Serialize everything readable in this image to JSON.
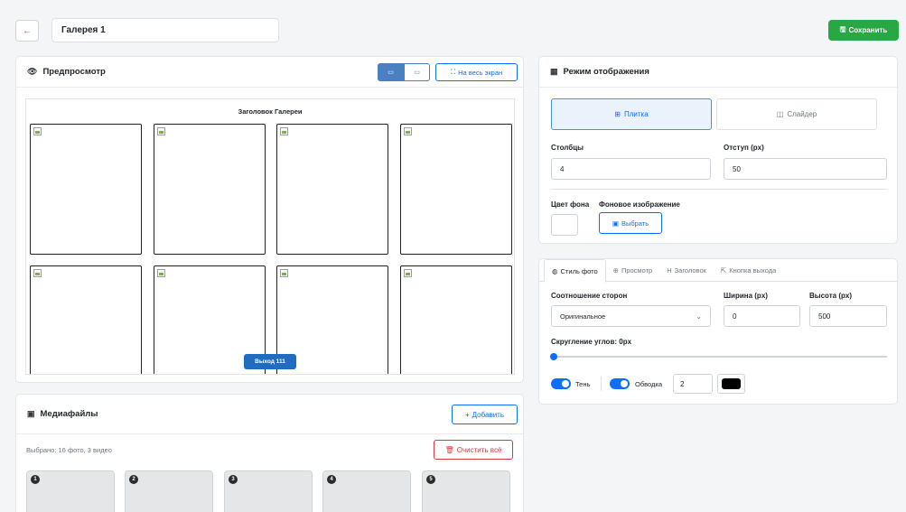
{
  "header": {
    "back_icon": "arrow-left-icon",
    "title_value": "Галерея 1",
    "save_label": "Сохранить",
    "save_icon": "floppy-icon",
    "save_color": "#28a745"
  },
  "preview": {
    "title": "Предпросмотр",
    "icon": "eye-icon",
    "fullscreen_label": "На весь экран",
    "gallery_title": "Заголовок Галереи",
    "exit_label": "Выход 111"
  },
  "media": {
    "title": "Медиафайлы",
    "add_label": "Добавить",
    "selected_text": "Выбрано: 16 фото, 3 видео",
    "clear_label": "Очистить всё",
    "thumb_numbers": [
      "1",
      "2",
      "3",
      "4",
      "5"
    ]
  },
  "display_mode": {
    "title": "Режим отображения",
    "tile_label": "Плитка",
    "slider_label": "Слайдер",
    "columns_label": "Столбцы",
    "columns_value": "4",
    "gap_label": "Отступ (px)",
    "gap_value": "50",
    "bg_color_label": "Цвет фона",
    "bg_image_label": "Фоновое изображение",
    "choose_label": "Выбрать"
  },
  "style": {
    "tabs": [
      "Стиль фото",
      "Просмотр",
      "Заголовок",
      "Кнопка выхода"
    ],
    "aspect_label": "Соотношение сторон",
    "aspect_value": "Оригинальное",
    "width_label": "Ширина (px)",
    "width_value": "0",
    "height_label": "Высота (px)",
    "height_value": "500",
    "radius_label": "Скругление углов: 0px",
    "radius_value": 0,
    "shadow_label": "Тень",
    "border_label": "Обводка",
    "border_width_value": "2",
    "border_color": "#000000"
  }
}
